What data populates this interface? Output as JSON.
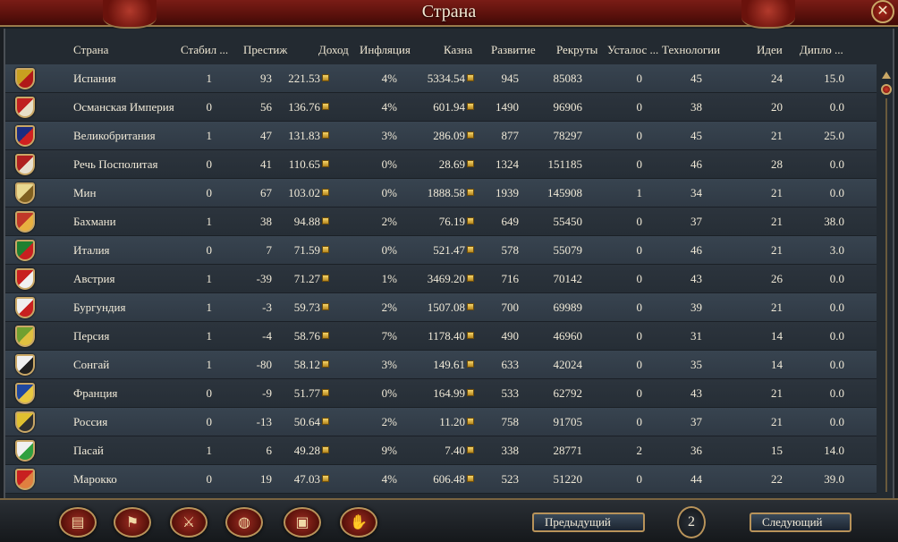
{
  "window": {
    "title": "Страна",
    "close_icon": "✕"
  },
  "columns": [
    {
      "key": "country",
      "label": "Страна"
    },
    {
      "key": "stability",
      "label": "Стабил ..."
    },
    {
      "key": "prestige",
      "label": "Престиж"
    },
    {
      "key": "income",
      "label": "Доход"
    },
    {
      "key": "inflation",
      "label": "Инфляция"
    },
    {
      "key": "treasury",
      "label": "Казна"
    },
    {
      "key": "development",
      "label": "Развитие"
    },
    {
      "key": "manpower",
      "label": "Рекруты"
    },
    {
      "key": "war_exhaustion",
      "label": "Усталос ..."
    },
    {
      "key": "technology",
      "label": "Технологии"
    },
    {
      "key": "ideas",
      "label": "Идеи"
    },
    {
      "key": "diplo",
      "label": "Дипло ..."
    }
  ],
  "rows": [
    {
      "name": "Испания",
      "stability": "1",
      "prestige": "93",
      "income": "221.53",
      "inflation": "4%",
      "treasury": "5334.54",
      "development": "945",
      "manpower": "85083",
      "war_exhaustion": "0",
      "technology": "45",
      "ideas": "24",
      "diplo": "15.0",
      "flag_colors": [
        "#c8a020",
        "#b01818"
      ]
    },
    {
      "name": "Османская Империя",
      "stability": "0",
      "prestige": "56",
      "income": "136.76",
      "inflation": "4%",
      "treasury": "601.94",
      "development": "1490",
      "manpower": "96906",
      "war_exhaustion": "0",
      "technology": "38",
      "ideas": "20",
      "diplo": "0.0",
      "flag_colors": [
        "#c02020",
        "#e8e0c8"
      ]
    },
    {
      "name": "Великобритания",
      "stability": "1",
      "prestige": "47",
      "income": "131.83",
      "inflation": "3%",
      "treasury": "286.09",
      "development": "877",
      "manpower": "78297",
      "war_exhaustion": "0",
      "technology": "45",
      "ideas": "21",
      "diplo": "25.0",
      "flag_colors": [
        "#1c2c80",
        "#d02020"
      ]
    },
    {
      "name": "Речь Посполитая",
      "stability": "0",
      "prestige": "41",
      "income": "110.65",
      "inflation": "0%",
      "treasury": "28.69",
      "development": "1324",
      "manpower": "151185",
      "war_exhaustion": "0",
      "technology": "46",
      "ideas": "28",
      "diplo": "0.0",
      "flag_colors": [
        "#b02020",
        "#e8e0d0"
      ]
    },
    {
      "name": "Мин",
      "stability": "0",
      "prestige": "67",
      "income": "103.02",
      "inflation": "0%",
      "treasury": "1888.58",
      "development": "1939",
      "manpower": "145908",
      "war_exhaustion": "1",
      "technology": "34",
      "ideas": "21",
      "diplo": "0.0",
      "flag_colors": [
        "#e8d890",
        "#806020"
      ]
    },
    {
      "name": "Бахмани",
      "stability": "1",
      "prestige": "38",
      "income": "94.88",
      "inflation": "2%",
      "treasury": "76.19",
      "development": "649",
      "manpower": "55450",
      "war_exhaustion": "0",
      "technology": "37",
      "ideas": "21",
      "diplo": "38.0",
      "flag_colors": [
        "#c03828",
        "#e8b040"
      ]
    },
    {
      "name": "Италия",
      "stability": "0",
      "prestige": "7",
      "income": "71.59",
      "inflation": "0%",
      "treasury": "521.47",
      "development": "578",
      "manpower": "55079",
      "war_exhaustion": "0",
      "technology": "46",
      "ideas": "21",
      "diplo": "3.0",
      "flag_colors": [
        "#208030",
        "#c82020"
      ]
    },
    {
      "name": "Австрия",
      "stability": "1",
      "prestige": "-39",
      "income": "71.27",
      "inflation": "1%",
      "treasury": "3469.20",
      "development": "716",
      "manpower": "70142",
      "war_exhaustion": "0",
      "technology": "43",
      "ideas": "26",
      "diplo": "0.0",
      "flag_colors": [
        "#c82020",
        "#f0f0f0"
      ]
    },
    {
      "name": "Бургундия",
      "stability": "1",
      "prestige": "-3",
      "income": "59.73",
      "inflation": "2%",
      "treasury": "1507.08",
      "development": "700",
      "manpower": "69989",
      "war_exhaustion": "0",
      "technology": "39",
      "ideas": "21",
      "diplo": "0.0",
      "flag_colors": [
        "#f0f0f0",
        "#c82020"
      ]
    },
    {
      "name": "Персия",
      "stability": "1",
      "prestige": "-4",
      "income": "58.76",
      "inflation": "7%",
      "treasury": "1178.40",
      "development": "490",
      "manpower": "46960",
      "war_exhaustion": "0",
      "technology": "31",
      "ideas": "14",
      "diplo": "0.0",
      "flag_colors": [
        "#70a030",
        "#e0c040"
      ]
    },
    {
      "name": "Сонгай",
      "stability": "1",
      "prestige": "-80",
      "income": "58.12",
      "inflation": "3%",
      "treasury": "149.61",
      "development": "633",
      "manpower": "42024",
      "war_exhaustion": "0",
      "technology": "35",
      "ideas": "14",
      "diplo": "0.0",
      "flag_colors": [
        "#f0f0f0",
        "#202020"
      ]
    },
    {
      "name": "Франция",
      "stability": "0",
      "prestige": "-9",
      "income": "51.77",
      "inflation": "0%",
      "treasury": "164.99",
      "development": "533",
      "manpower": "62792",
      "war_exhaustion": "0",
      "technology": "43",
      "ideas": "21",
      "diplo": "0.0",
      "flag_colors": [
        "#2048a0",
        "#e8c840"
      ]
    },
    {
      "name": "Россия",
      "stability": "0",
      "prestige": "-13",
      "income": "50.64",
      "inflation": "2%",
      "treasury": "11.20",
      "development": "758",
      "manpower": "91705",
      "war_exhaustion": "0",
      "technology": "37",
      "ideas": "21",
      "diplo": "0.0",
      "flag_colors": [
        "#e0c030",
        "#303030"
      ]
    },
    {
      "name": "Пасай",
      "stability": "1",
      "prestige": "6",
      "income": "49.28",
      "inflation": "9%",
      "treasury": "7.40",
      "development": "338",
      "manpower": "28771",
      "war_exhaustion": "2",
      "technology": "36",
      "ideas": "15",
      "diplo": "14.0",
      "flag_colors": [
        "#f0f0f0",
        "#30a040"
      ]
    },
    {
      "name": "Марокко",
      "stability": "0",
      "prestige": "19",
      "income": "47.03",
      "inflation": "4%",
      "treasury": "606.48",
      "development": "523",
      "manpower": "51220",
      "war_exhaustion": "0",
      "technology": "44",
      "ideas": "22",
      "diplo": "39.0",
      "flag_colors": [
        "#c82020",
        "#e08040"
      ]
    }
  ],
  "toolbar": [
    {
      "name": "ledger-icon",
      "glyph": "▤"
    },
    {
      "name": "flag-icon",
      "glyph": "⚑"
    },
    {
      "name": "crossed-swords-icon",
      "glyph": "⚔"
    },
    {
      "name": "coins-icon",
      "glyph": "◍"
    },
    {
      "name": "chest-icon",
      "glyph": "▣"
    },
    {
      "name": "handshake-icon",
      "glyph": "✋"
    }
  ],
  "pagination": {
    "prev_label": "Предыдущий",
    "next_label": "Следующий",
    "page": "2"
  }
}
